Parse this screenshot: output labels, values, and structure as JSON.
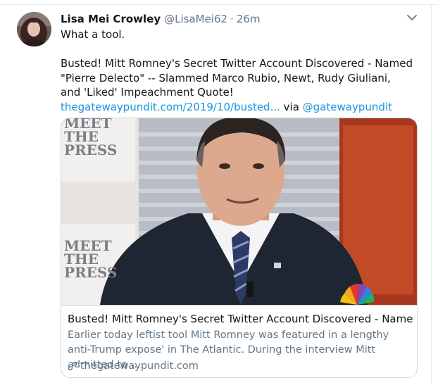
{
  "tweet": {
    "display_name": "Lisa Mei Crowley",
    "handle": "@LisaMei62",
    "separator": "·",
    "time": "26m",
    "text_line1": "What a tool.",
    "text_body": "Busted! Mitt Romney's Secret Twitter Account Discovered - Named \"Pierre Delecto\" -- Slammed Marco Rubio, Newt, Rudy Giuliani, and 'Liked' Impeachment Quote! ",
    "link_text": "thegatewaypundit.com/2019/10/busted...",
    "via_text": " via ",
    "mention": "@gatewaypundit"
  },
  "card": {
    "image_text_top": "MEET THE PRESS",
    "image_text_bottom": "MEET THE PRESS",
    "title": "Busted! Mitt Romney's Secret Twitter Account Discovered - Named \"Pier...",
    "description": "Earlier today leftist tool Mitt Romney was featured in a lengthy anti-Trump expose' in The Atlantic. During the interview Mitt admitted to ...",
    "domain": "thegatewaypundit.com"
  },
  "icons": {
    "menu": "chevron-down-icon",
    "link": "link-icon",
    "network_logo": "peacock-logo"
  },
  "colors": {
    "link": "#1b95e0",
    "text": "#14171a",
    "secondary": "#657786",
    "border": "#ccd6dd"
  }
}
